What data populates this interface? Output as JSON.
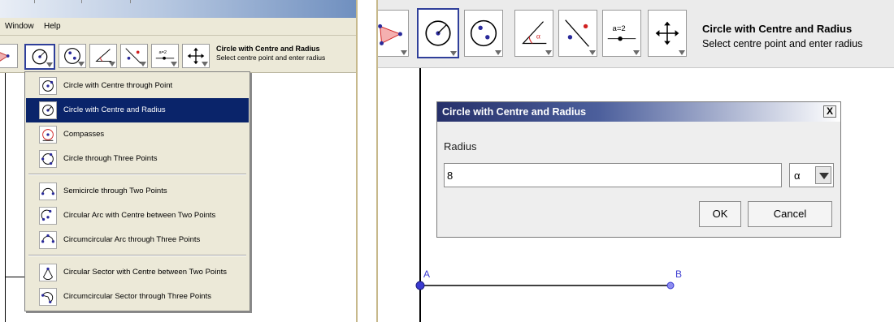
{
  "left": {
    "menubar": [
      "Window",
      "Help"
    ],
    "tool_title": "Circle with Centre and Radius",
    "tool_hint": "Select centre point and enter radius",
    "menu_items": [
      {
        "label": "Circle with Centre through Point",
        "icon": "circle-center-point-icon"
      },
      {
        "label": "Circle with Centre and Radius",
        "icon": "circle-center-radius-icon",
        "selected": true
      },
      {
        "label": "Compasses",
        "icon": "compasses-icon"
      },
      {
        "label": "Circle through Three Points",
        "icon": "circle-three-points-icon"
      },
      {
        "label": "Semicircle through Two Points",
        "icon": "semicircle-icon"
      },
      {
        "label": "Circular Arc with Centre between Two Points",
        "icon": "circular-arc-icon"
      },
      {
        "label": "Circumcircular Arc through Three Points",
        "icon": "circumcircular-arc-icon"
      },
      {
        "label": "Circular Sector with Centre between Two Points",
        "icon": "circular-sector-icon"
      },
      {
        "label": "Circumcircular Sector through Three Points",
        "icon": "circumcircular-sector-icon"
      }
    ]
  },
  "right": {
    "tool_title": "Circle with Centre and Radius",
    "tool_hint": "Select centre point and enter radius",
    "dialog": {
      "title": "Circle with Centre and Radius",
      "close": "X",
      "radius_label": "Radius",
      "radius_value": "8",
      "symbol_value": "α",
      "ok": "OK",
      "cancel": "Cancel"
    },
    "points": {
      "a": "A",
      "b": "B"
    }
  },
  "colors": {
    "selection": "#0a246a",
    "tool_border_selected": "#2f3f9a",
    "point": "#3a3ad0",
    "guide_border": "#c7b98c"
  }
}
